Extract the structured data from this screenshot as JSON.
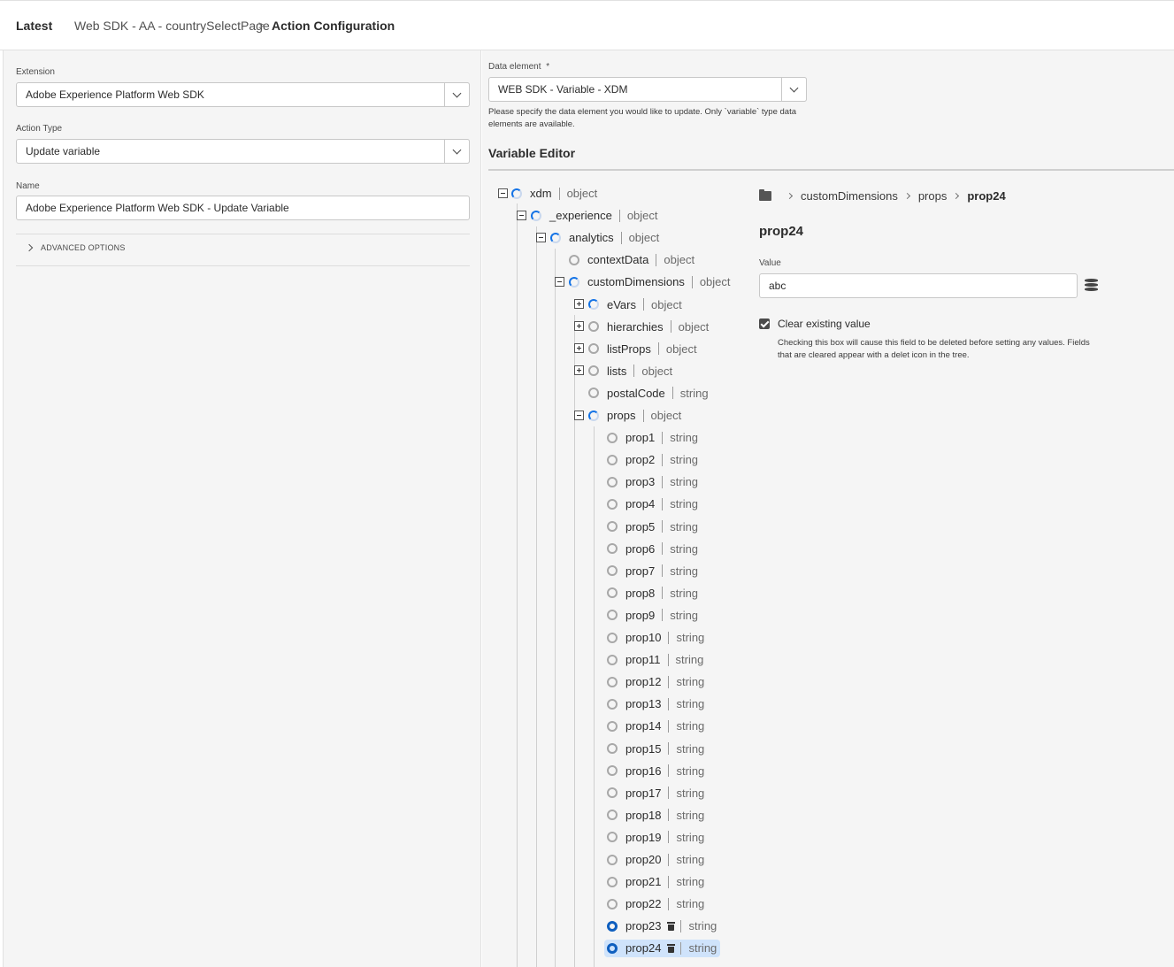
{
  "header": {
    "latest": "Latest",
    "crumb1": "Web SDK - AA - countrySelectPage",
    "separator": ">",
    "crumb2": "Action Configuration"
  },
  "left": {
    "extension_label": "Extension",
    "extension_value": "Adobe Experience Platform Web SDK",
    "action_type_label": "Action Type",
    "action_type_value": "Update variable",
    "name_label": "Name",
    "name_value": "Adobe Experience Platform Web SDK - Update Variable",
    "advanced_options": "ADVANCED OPTIONS"
  },
  "right": {
    "data_element_label": "Data element",
    "required_marker": "*",
    "data_element_value": "WEB SDK - Variable - XDM",
    "data_element_help": "Please specify the data element you would like to update. Only `variable` type data elements are available.",
    "variable_editor_title": "Variable Editor"
  },
  "tree": {
    "nodes": [
      {
        "name": "xdm",
        "type": "object"
      },
      {
        "name": "_experience",
        "type": "object"
      },
      {
        "name": "analytics",
        "type": "object"
      },
      {
        "name": "contextData",
        "type": "object"
      },
      {
        "name": "customDimensions",
        "type": "object"
      },
      {
        "name": "eVars",
        "type": "object"
      },
      {
        "name": "hierarchies",
        "type": "object"
      },
      {
        "name": "listProps",
        "type": "object"
      },
      {
        "name": "lists",
        "type": "object"
      },
      {
        "name": "postalCode",
        "type": "string"
      },
      {
        "name": "props",
        "type": "object"
      },
      {
        "name": "prop1",
        "type": "string"
      },
      {
        "name": "prop2",
        "type": "string"
      },
      {
        "name": "prop3",
        "type": "string"
      },
      {
        "name": "prop4",
        "type": "string"
      },
      {
        "name": "prop5",
        "type": "string"
      },
      {
        "name": "prop6",
        "type": "string"
      },
      {
        "name": "prop7",
        "type": "string"
      },
      {
        "name": "prop8",
        "type": "string"
      },
      {
        "name": "prop9",
        "type": "string"
      },
      {
        "name": "prop10",
        "type": "string"
      },
      {
        "name": "prop11",
        "type": "string"
      },
      {
        "name": "prop12",
        "type": "string"
      },
      {
        "name": "prop13",
        "type": "string"
      },
      {
        "name": "prop14",
        "type": "string"
      },
      {
        "name": "prop15",
        "type": "string"
      },
      {
        "name": "prop16",
        "type": "string"
      },
      {
        "name": "prop17",
        "type": "string"
      },
      {
        "name": "prop18",
        "type": "string"
      },
      {
        "name": "prop19",
        "type": "string"
      },
      {
        "name": "prop20",
        "type": "string"
      },
      {
        "name": "prop21",
        "type": "string"
      },
      {
        "name": "prop22",
        "type": "string"
      },
      {
        "name": "prop23",
        "type": "string"
      },
      {
        "name": "prop24",
        "type": "string"
      }
    ]
  },
  "detail": {
    "breadcrumb": [
      "customDimensions",
      "props",
      "prop24"
    ],
    "title": "prop24",
    "value_label": "Value",
    "value": "abc",
    "clear_label": "Clear existing value",
    "clear_checked": true,
    "clear_help": "Checking this box will cause this field to be deleted before setting any values. Fields that are cleared appear with a delet icon in the tree."
  },
  "colors": {
    "accent": "#1473e6",
    "selected_bg": "#cfe3fb"
  }
}
